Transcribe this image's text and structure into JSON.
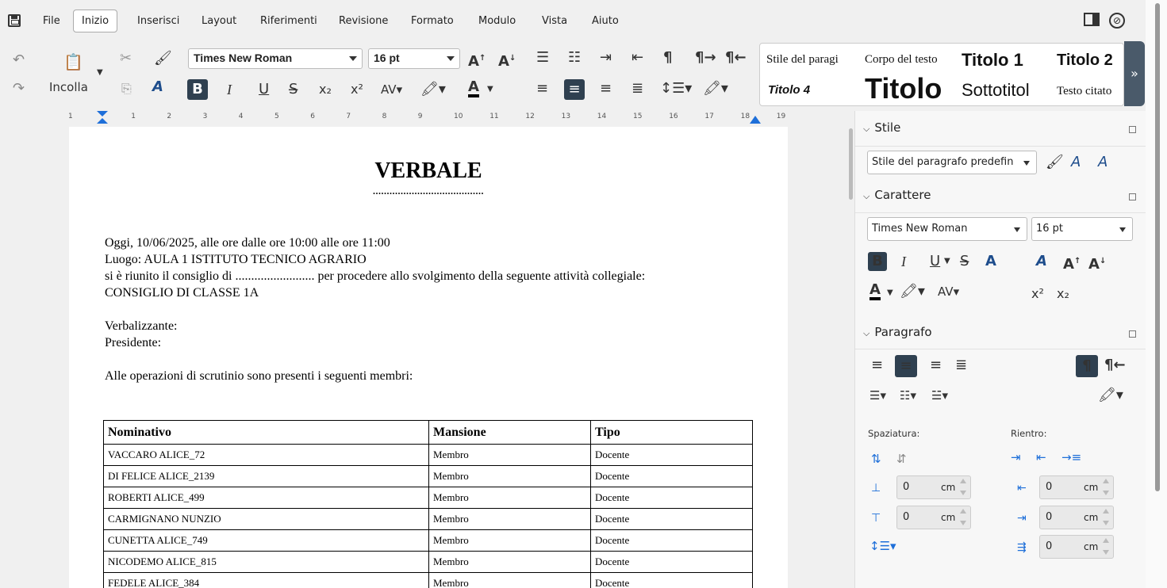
{
  "menu": {
    "items": [
      "File",
      "Inizio",
      "Inserisci",
      "Layout",
      "Riferimenti",
      "Revisione",
      "Formato",
      "Modulo",
      "Vista",
      "Aiuto"
    ],
    "active": "Inizio"
  },
  "toolbar": {
    "paste_label": "Incolla",
    "font_name": "Times New Roman",
    "font_size": "16 pt",
    "bold": "B",
    "italic": "I",
    "underline": "U",
    "paragraph_mark": "¶"
  },
  "style_gallery": {
    "row1": [
      "Stile del paragi",
      "Corpo del testo",
      "Titolo 1",
      "Titolo 2"
    ],
    "row2": [
      "Titolo 4",
      "Titolo",
      "Sottotitol",
      "Testo citato"
    ]
  },
  "ruler": {
    "numbers": [
      "1",
      "1",
      "2",
      "3",
      "4",
      "5",
      "6",
      "7",
      "8",
      "9",
      "10",
      "11",
      "12",
      "13",
      "14",
      "15",
      "16",
      "17",
      "18",
      "19"
    ]
  },
  "document": {
    "title": "VERBALE",
    "title_dots": "........................................",
    "line1": "Oggi, 10/06/2025, alle ore dalle ore 10:00 alle ore 11:00",
    "line2": "Luogo: AULA 1 ISTITUTO TECNICO AGRARIO",
    "line3": "si è riunito il consiglio di ......................... per procedere allo svolgimento della seguente attività collegiale:",
    "line4": "CONSIGLIO DI CLASSE 1A",
    "verbalizzante": "Verbalizzante:",
    "presidente": "Presidente:",
    "members_intro": "Alle operazioni di scrutinio sono presenti i seguenti membri:",
    "table": {
      "headers": [
        "Nominativo",
        "Mansione",
        "Tipo"
      ],
      "rows": [
        [
          "VACCARO ALICE_72",
          "Membro",
          "Docente"
        ],
        [
          "DI FELICE ALICE_2139",
          "Membro",
          "Docente"
        ],
        [
          "ROBERTI ALICE_499",
          "Membro",
          "Docente"
        ],
        [
          "CARMIGNANO  NUNZIO",
          "Membro",
          "Docente"
        ],
        [
          "CUNETTA ALICE_749",
          "Membro",
          "Docente"
        ],
        [
          "NICODEMO ALICE_815",
          "Membro",
          "Docente"
        ],
        [
          "FEDELE ALICE_384",
          "Membro",
          "Docente"
        ]
      ]
    }
  },
  "panel": {
    "stile": {
      "title": "Stile",
      "paragraph_style": "Stile del paragrafo predefin"
    },
    "carattere": {
      "title": "Carattere",
      "font_name": "Times New Roman",
      "font_size": "16 pt"
    },
    "paragrafo": {
      "title": "Paragrafo",
      "spaziatura_label": "Spaziatura:",
      "rientro_label": "Rientro:",
      "spacing_above": "0",
      "spacing_below": "0",
      "indent_before": "0",
      "indent_after": "0",
      "indent_first": "0",
      "unit": "cm"
    }
  },
  "colors": {
    "active_button": "#2f4050",
    "gallery_expand": "#4a5a6a",
    "ruler_marker": "#1e6fd9"
  }
}
